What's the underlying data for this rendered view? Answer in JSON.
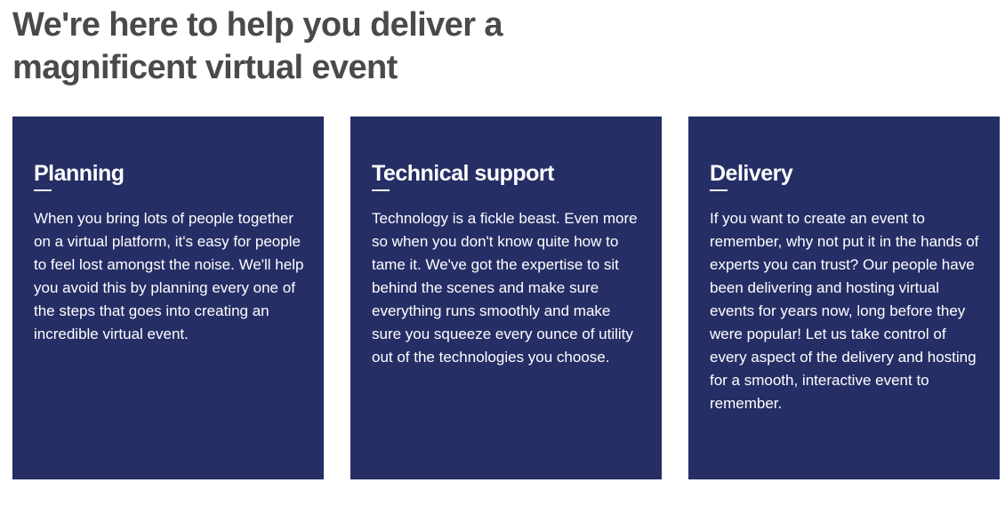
{
  "header": {
    "title": "We're here to help you deliver a magnificent virtual event"
  },
  "colors": {
    "card_background": "#262e66",
    "title_text": "#4a4a4a",
    "card_text": "#ffffff"
  },
  "cards": [
    {
      "heading": "Planning",
      "body": "When you bring lots of people together on a virtual platform, it's easy for people to feel lost amongst the noise. We'll help you avoid this by planning every one of the steps that goes into creating an incredible virtual event."
    },
    {
      "heading": "Technical support",
      "body": "Technology is a fickle beast. Even more so when you don't know quite how to tame it. We've got the expertise to sit behind the scenes and make sure everything runs smoothly and make sure you squeeze every ounce of utility out of the technologies you choose."
    },
    {
      "heading": "Delivery",
      "body": "If you want to create an event to remember, why not put it in the hands of experts you can trust? Our people have been delivering and hosting virtual events for years now, long before they were popular! Let us take control of every aspect of the delivery and hosting for a smooth, interactive event to remember."
    }
  ]
}
